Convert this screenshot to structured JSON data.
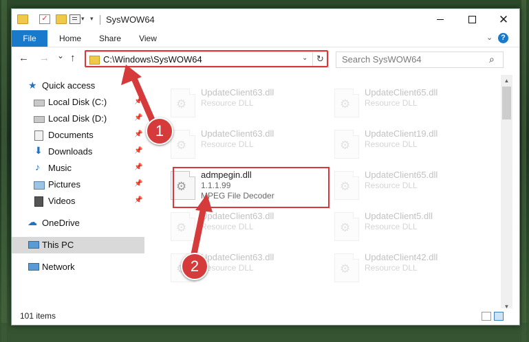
{
  "window": {
    "title": "SysWOW64",
    "controls": [
      "minimize-icon",
      "maximize-icon",
      "close-icon"
    ],
    "close_glyph": "✕"
  },
  "ribbon": {
    "tabs": [
      "File",
      "Home",
      "Share",
      "View"
    ],
    "accent": "#1979ca"
  },
  "navigation": {
    "back_glyph": "←",
    "forward_glyph": "→",
    "recent_glyph": "⌄",
    "up_glyph": "↑"
  },
  "address": {
    "path": "C:\\Windows\\SysWOW64",
    "refresh_glyph": "↻"
  },
  "search": {
    "placeholder": "Search SysWOW64"
  },
  "sidebar": {
    "items": [
      {
        "label": "Quick access",
        "icon": "star-icon"
      },
      {
        "label": "Local Disk (C:)",
        "icon": "drive-icon"
      },
      {
        "label": "Local Disk (D:)",
        "icon": "drive-icon"
      },
      {
        "label": "Documents",
        "icon": "documents-icon"
      },
      {
        "label": "Downloads",
        "icon": "download-icon"
      },
      {
        "label": "Music",
        "icon": "music-icon"
      },
      {
        "label": "Pictures",
        "icon": "pictures-icon"
      },
      {
        "label": "Videos",
        "icon": "videos-icon"
      },
      {
        "label": "OneDrive",
        "icon": "cloud-icon"
      },
      {
        "label": "This PC",
        "icon": "computer-icon"
      },
      {
        "label": "Network",
        "icon": "network-icon"
      }
    ]
  },
  "files": [
    {
      "name": "UpdateClient63.dll",
      "desc": "Resource DLL"
    },
    {
      "name": "UpdateClient65.dll",
      "desc": "Resource DLL"
    },
    {
      "name": "UpdateClient63.dll",
      "desc": "Resource DLL"
    },
    {
      "name": "UpdateClient19.dll",
      "desc": "Resource DLL"
    },
    {
      "name": "admpegin.dll",
      "version": "1.1.1.99",
      "desc": "MPEG File Decoder"
    },
    {
      "name": "UpdateClient65.dll",
      "desc": "Resource DLL"
    },
    {
      "name": "UpdateClient63.dll",
      "desc": "Resource DLL"
    },
    {
      "name": "UpdateClient5.dll",
      "desc": "Resource DLL"
    },
    {
      "name": "UpdateClient63.dll",
      "desc": "Resource DLL"
    },
    {
      "name": "UpdateClient42.dll",
      "desc": "Resource DLL"
    }
  ],
  "status": {
    "item_count": "101 items"
  },
  "annotations": {
    "step1": "1",
    "step2": "2",
    "color": "#d63b3b"
  }
}
